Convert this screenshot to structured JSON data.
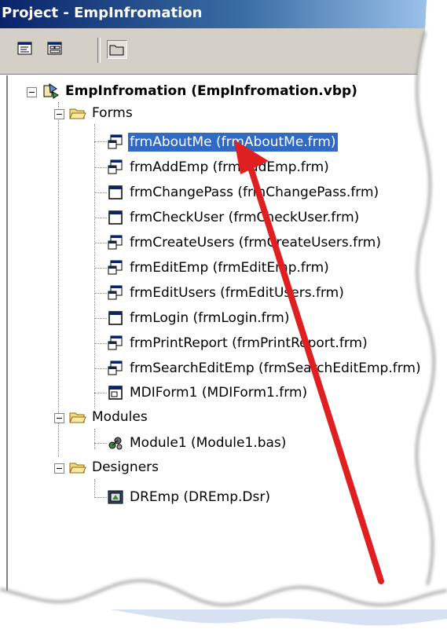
{
  "window": {
    "title": "Project - EmpInfromation"
  },
  "toolbar": {
    "buttons": [
      {
        "icon": "view-code-icon"
      },
      {
        "icon": "view-object-icon"
      },
      {
        "icon": "toggle-folders-icon",
        "selected": true
      }
    ]
  },
  "tree": {
    "project": {
      "label": "EmpInfromation (EmpInfromation.vbp)"
    },
    "folders": [
      {
        "label": "Forms",
        "items": [
          {
            "label": "frmAboutMe (frmAboutMe.frm)",
            "selected": true,
            "icon": "form-icon"
          },
          {
            "label": "frmAddEmp (frmAddEmp.frm)",
            "icon": "form-icon"
          },
          {
            "label": "frmChangePass (frmChangePass.frm)",
            "icon": "dialog-form-icon"
          },
          {
            "label": "frmCheckUser (frmCheckUser.frm)",
            "icon": "dialog-form-icon"
          },
          {
            "label": "frmCreateUsers (frmCreateUsers.frm)",
            "icon": "form-icon"
          },
          {
            "label": "frmEditEmp (frmEditEmp.frm)",
            "icon": "form-icon"
          },
          {
            "label": "frmEditUsers (frmEditUsers.frm)",
            "icon": "form-icon"
          },
          {
            "label": "frmLogin (frmLogin.frm)",
            "icon": "dialog-form-icon"
          },
          {
            "label": "frmPrintReport (frmPrintReport.frm)",
            "icon": "form-icon"
          },
          {
            "label": "frmSearchEditEmp (frmSearchEditEmp.frm)",
            "icon": "form-icon"
          },
          {
            "label": "MDIForm1 (MDIForm1.frm)",
            "icon": "mdi-form-icon"
          }
        ]
      },
      {
        "label": "Modules",
        "items": [
          {
            "label": "Module1 (Module1.bas)",
            "icon": "module-icon"
          }
        ]
      },
      {
        "label": "Designers",
        "items": [
          {
            "label": "DREmp (DREmp.Dsr)",
            "icon": "designer-icon"
          }
        ]
      }
    ]
  },
  "annotation": {
    "arrow_color": "#e02020"
  },
  "colors": {
    "selection": "#316ac5",
    "titlebar": "#0a246a",
    "toolbar_bg": "#d4d0c8"
  }
}
